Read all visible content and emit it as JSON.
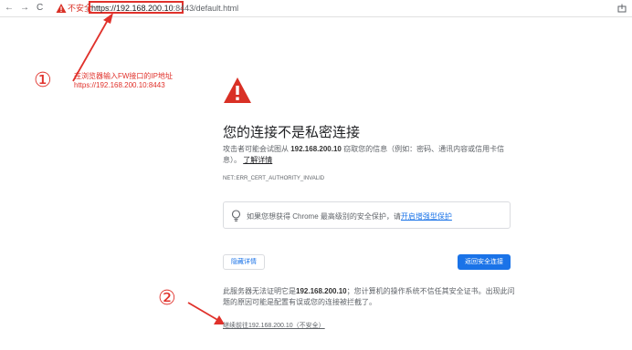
{
  "browser": {
    "nav_back": "←",
    "nav_forward": "→",
    "nav_reload": "C",
    "security_label": "不安全",
    "url_scheme": "https://",
    "url_host": "192.168.200.10",
    "url_port": ":8443",
    "url_path": "/default.html"
  },
  "annotations": {
    "step1_number": "①",
    "step1_line1": "在浏览器输入FW接口的IP地址",
    "step1_line2": "https://192.168.200.10:8443",
    "step2_number": "②",
    "accent_color": "#e0312b"
  },
  "interstitial": {
    "heading": "您的连接不是私密连接",
    "desc_before": "攻击者可能会试图从 ",
    "desc_host": "192.168.200.10",
    "desc_after": " 窃取您的信息（例如：密码、通讯内容或信用卡信息）。",
    "learn_more": "了解详情",
    "error_code": "NET::ERR_CERT_AUTHORITY_INVALID",
    "safe_browsing_text": "如果您想获得 Chrome 最高级别的安全保护，请",
    "safe_browsing_link": "开启增强型保护",
    "details_button": "隐藏详情",
    "back_button": "返回安全连接",
    "explain_before": "此服务器无法证明它是",
    "explain_host": "192.168.200.10",
    "explain_after": "；您计算机的操作系统不信任其安全证书。出现此问题的原因可能是配置有误或您的连接被拦截了。",
    "proceed_link": "继续前往192.168.200.10（不安全）"
  }
}
